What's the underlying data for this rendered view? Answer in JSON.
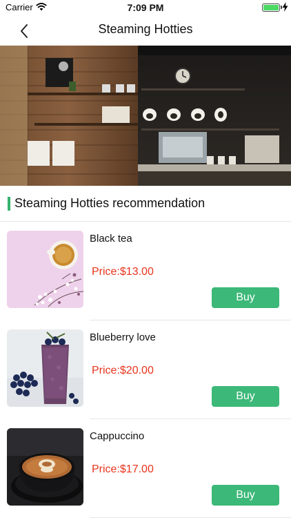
{
  "status_bar": {
    "carrier": "Carrier",
    "time": "7:09 PM",
    "battery_level": 1.0
  },
  "nav": {
    "title": "Steaming Hotties",
    "back_icon": "chevron-left-icon"
  },
  "section": {
    "title": "Steaming Hotties recommendation",
    "accent_color": "#35b36b"
  },
  "products": [
    {
      "name": "Black tea",
      "price": "Price:$13.00",
      "buy_label": "Buy"
    },
    {
      "name": "Blueberry love",
      "price": "Price:$20.00",
      "buy_label": "Buy"
    },
    {
      "name": "Cappuccino",
      "price": "Price:$17.00",
      "buy_label": "Buy"
    }
  ],
  "colors": {
    "buy_button": "#3cb878",
    "price": "#e8331c"
  }
}
